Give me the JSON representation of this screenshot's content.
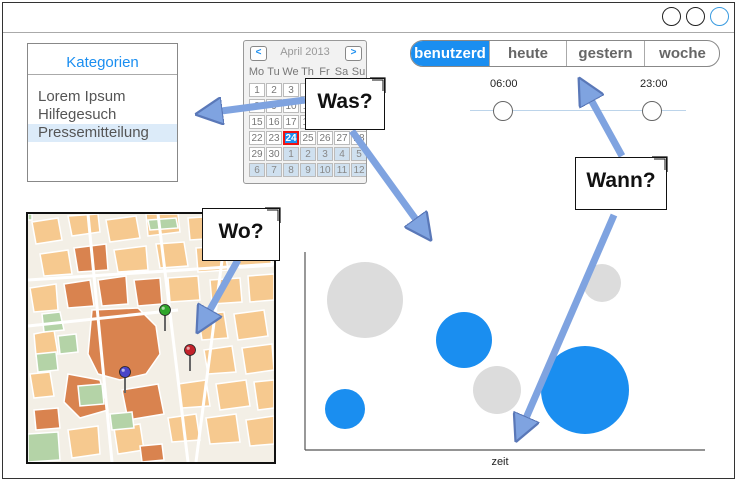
{
  "window": {
    "controls": [
      "minimize",
      "maximize",
      "close"
    ]
  },
  "categories": {
    "title": "Kategorien",
    "items": [
      "Lorem Ipsum",
      "Hilfegesuch",
      "Pressemitteilung"
    ],
    "selected_index": 2
  },
  "calendar": {
    "month_label": "April 2013",
    "prev_label": "<",
    "next_label": ">",
    "weekdays": [
      "Mo",
      "Tu",
      "We",
      "Th",
      "Fr",
      "Sa",
      "Su"
    ],
    "weeks": [
      [
        "1",
        "2",
        "3",
        "4",
        "5",
        "6",
        "7"
      ],
      [
        "8",
        "9",
        "10",
        "11",
        "12",
        "13",
        "14"
      ],
      [
        "15",
        "16",
        "17",
        "18",
        "19",
        "20",
        "21"
      ],
      [
        "22",
        "23",
        "24",
        "25",
        "26",
        "27",
        "28"
      ],
      [
        "29",
        "30",
        "1",
        "2",
        "3",
        "4",
        "5"
      ],
      [
        "6",
        "7",
        "8",
        "9",
        "10",
        "11",
        "12"
      ]
    ],
    "selected_day": "24"
  },
  "time_filter": {
    "options": [
      "benutzerd",
      "heute",
      "gestern",
      "woche"
    ],
    "active": "benutzerd",
    "range_start_label": "06:00",
    "range_end_label": "23:00"
  },
  "callouts": {
    "was": "Was?",
    "wann": "Wann?",
    "wo": "Wo?"
  },
  "chart_data": {
    "type": "scatter",
    "xlabel": "zeit",
    "ylabel": "",
    "points": [
      {
        "color": "#dcdcdc"
      },
      {
        "color": "#1a8ef0"
      },
      {
        "color": "#dcdcdc"
      },
      {
        "color": "#dcdcdc"
      },
      {
        "color": "#1a8ef0"
      },
      {
        "color": "#1a8ef0"
      }
    ]
  },
  "map": {
    "pins": [
      {
        "color": "#2fa52b",
        "name": "green"
      },
      {
        "color": "#c2222a",
        "name": "red"
      },
      {
        "color": "#4a45c8",
        "name": "blue"
      }
    ]
  },
  "colors": {
    "accent": "#1a8ef0",
    "arrow": "#7fa3e0",
    "muted_bubble": "#dcdcdc"
  }
}
